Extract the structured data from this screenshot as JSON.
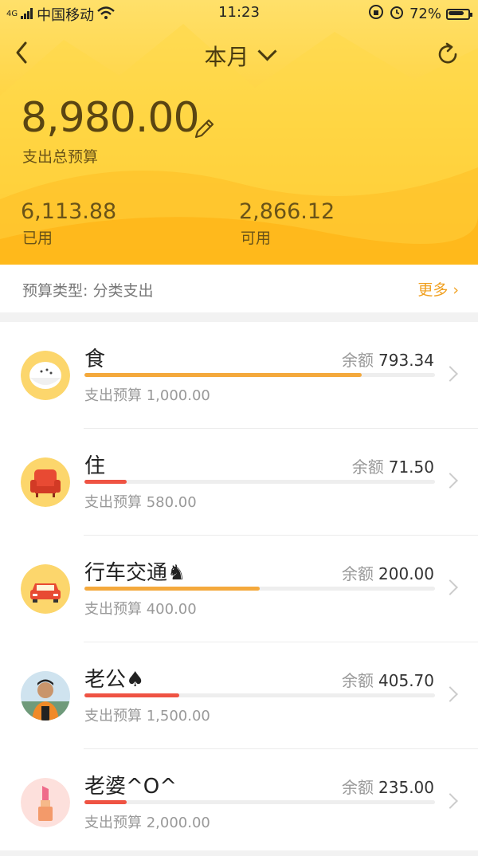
{
  "status_bar": {
    "carrier": "中国移动",
    "network": "4G",
    "time": "11:23",
    "battery": "72%"
  },
  "header": {
    "title": "本月"
  },
  "summary": {
    "total": "8,980.00",
    "total_label": "支出总预算",
    "used": "6,113.88",
    "used_label": "已用",
    "available": "2,866.12",
    "available_label": "可用"
  },
  "budget_type": {
    "label": "预算类型: 分类支出",
    "more": "更多 ›"
  },
  "colors": {
    "accent": "#f0a020",
    "orange_bar": "#f4a93c",
    "red_bar": "#ef5343",
    "header_yellow": "#ffd23c"
  },
  "categories": [
    {
      "name": "食",
      "remain_label": "余额",
      "remain": "793.34",
      "budget": "支出预算 1,000.00",
      "progress": 0.79,
      "color": "#f4a93c",
      "icon": "rice-bowl-icon"
    },
    {
      "name": "住",
      "remain_label": "余额",
      "remain": "71.50",
      "budget": "支出预算 580.00",
      "progress": 0.12,
      "color": "#ef5343",
      "icon": "armchair-icon"
    },
    {
      "name": "行车交通♞",
      "remain_label": "余额",
      "remain": "200.00",
      "budget": "支出预算 400.00",
      "progress": 0.5,
      "color": "#f4a93c",
      "icon": "car-icon"
    },
    {
      "name": "老公♠",
      "remain_label": "余额",
      "remain": "405.70",
      "budget": "支出预算 1,500.00",
      "progress": 0.27,
      "color": "#ef5343",
      "icon": "avatar-photo-icon"
    },
    {
      "name": "老婆^O^",
      "remain_label": "余额",
      "remain": "235.00",
      "budget": "支出预算 2,000.00",
      "progress": 0.12,
      "color": "#ef5343",
      "icon": "lipstick-icon"
    }
  ]
}
